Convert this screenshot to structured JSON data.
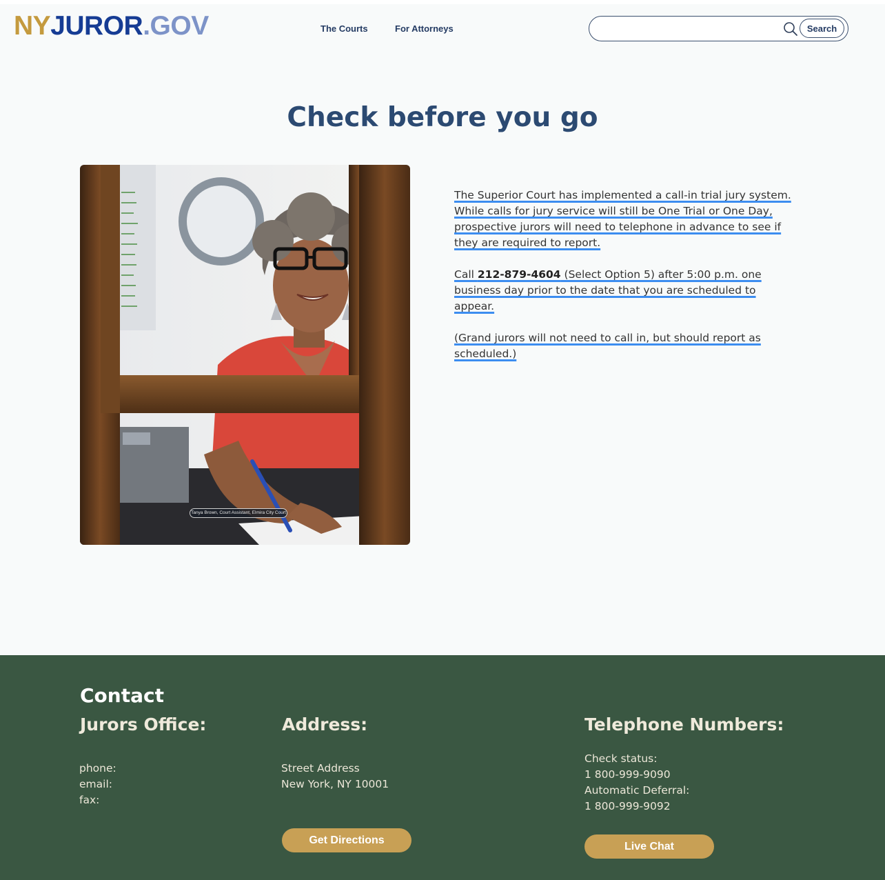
{
  "header": {
    "logo": {
      "ny": "NY",
      "juror": "JUROR",
      "gov": ".GOV"
    },
    "nav": {
      "courts": "The Courts",
      "attorneys": "For Attorneys"
    },
    "search": {
      "placeholder": "",
      "value": "",
      "button_label": "Search"
    }
  },
  "main": {
    "title": "Check before you go",
    "photo": {
      "caption": "Tanya Brown, Court Assistant, Elmira City Court"
    },
    "paragraphs": {
      "p1": "The Superior Court has implemented a call-in trial jury system. While calls for jury service will still be One Trial or One Day, prospective jurors will need to telephone in advance to see if they are required to report.",
      "p2_prefix": "Call ",
      "p2_phone": "212-879-4604",
      "p2_suffix": " (Select Option 5) after 5:00 p.m. one business day prior to the date that you are scheduled to appear.",
      "p3": "(Grand jurors will not need to call in, but should report as scheduled.)"
    }
  },
  "footer": {
    "contact_title": "Contact",
    "jurors_office": {
      "title": "Jurors Office:",
      "phone_label": "phone:",
      "email_label": "email:",
      "fax_label": "fax:"
    },
    "address": {
      "title": "Address:",
      "line1": "Street Address",
      "line2": "New York, NY 10001",
      "button_label": "Get Directions"
    },
    "telephone": {
      "title": "Telephone Numbers:",
      "status_label": "Check status:",
      "status_number": "1 800-999-9090",
      "deferral_label": "Automatic Deferral:",
      "deferral_number": "1 800-999-9092",
      "button_label": "Live Chat"
    }
  },
  "colors": {
    "logo_ny": "#c49a3e",
    "logo_juror": "#163c94",
    "logo_gov": "#7d93c8",
    "title": "#2c4a72",
    "highlight_underline": "#3c8df0",
    "footer_bg": "#3a5742",
    "button_gold": "#c8a055"
  }
}
